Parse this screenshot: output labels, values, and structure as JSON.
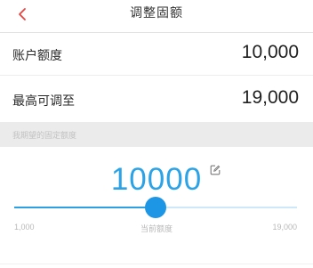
{
  "header": {
    "title": "调整固额",
    "back_icon": "chevron-left-icon",
    "accent_color": "#e64340"
  },
  "account_limit": {
    "label": "账户额度",
    "value": "10,000"
  },
  "max_adjust": {
    "label": "最高可调至",
    "value": "19,000"
  },
  "section": {
    "label": "我期望的固定额度"
  },
  "amount": {
    "value": "10000",
    "edit_icon": "edit-icon",
    "color": "#2ba3e6"
  },
  "slider": {
    "min": 1000,
    "max": 19000,
    "value": 10000,
    "min_label": "1,000",
    "max_label": "19,000",
    "current_label": "当前额度"
  }
}
